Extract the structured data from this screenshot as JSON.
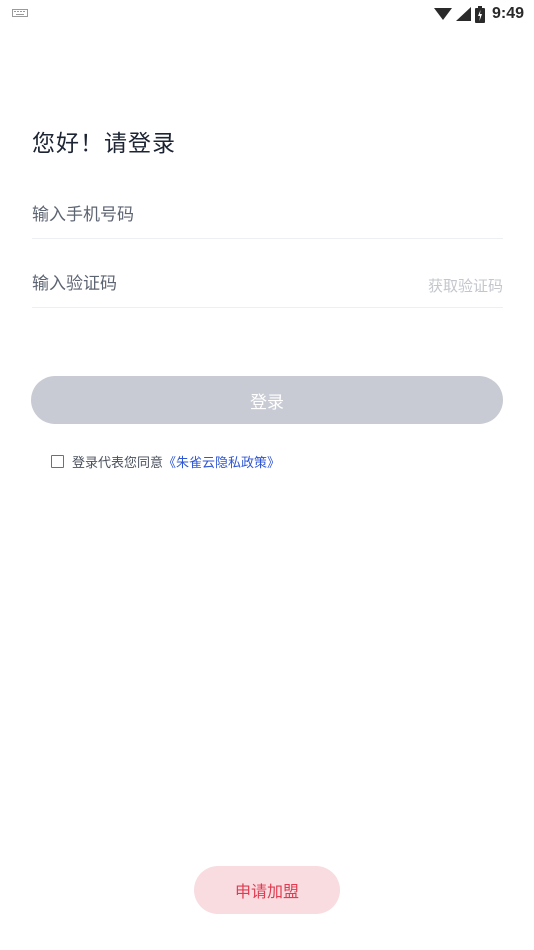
{
  "status_bar": {
    "time": "9:49",
    "icons": [
      "keyboard-icon",
      "wifi-icon",
      "cellular-signal-icon",
      "battery-icon"
    ]
  },
  "login": {
    "greeting": "您好！请登录",
    "phone_placeholder": "输入手机号码",
    "code_placeholder": "输入验证码",
    "get_code_label": "获取验证码",
    "login_button_label": "登录",
    "agreement_prefix": "登录代表您同意",
    "privacy_link_label": "《朱雀云隐私政策》",
    "apply_button_label": "申请加盟"
  },
  "colors": {
    "login_button_disabled": "#c8cbd3",
    "link": "#2f56d3",
    "apply_button_bg": "#f8dce0",
    "apply_button_text": "#e03b50"
  }
}
